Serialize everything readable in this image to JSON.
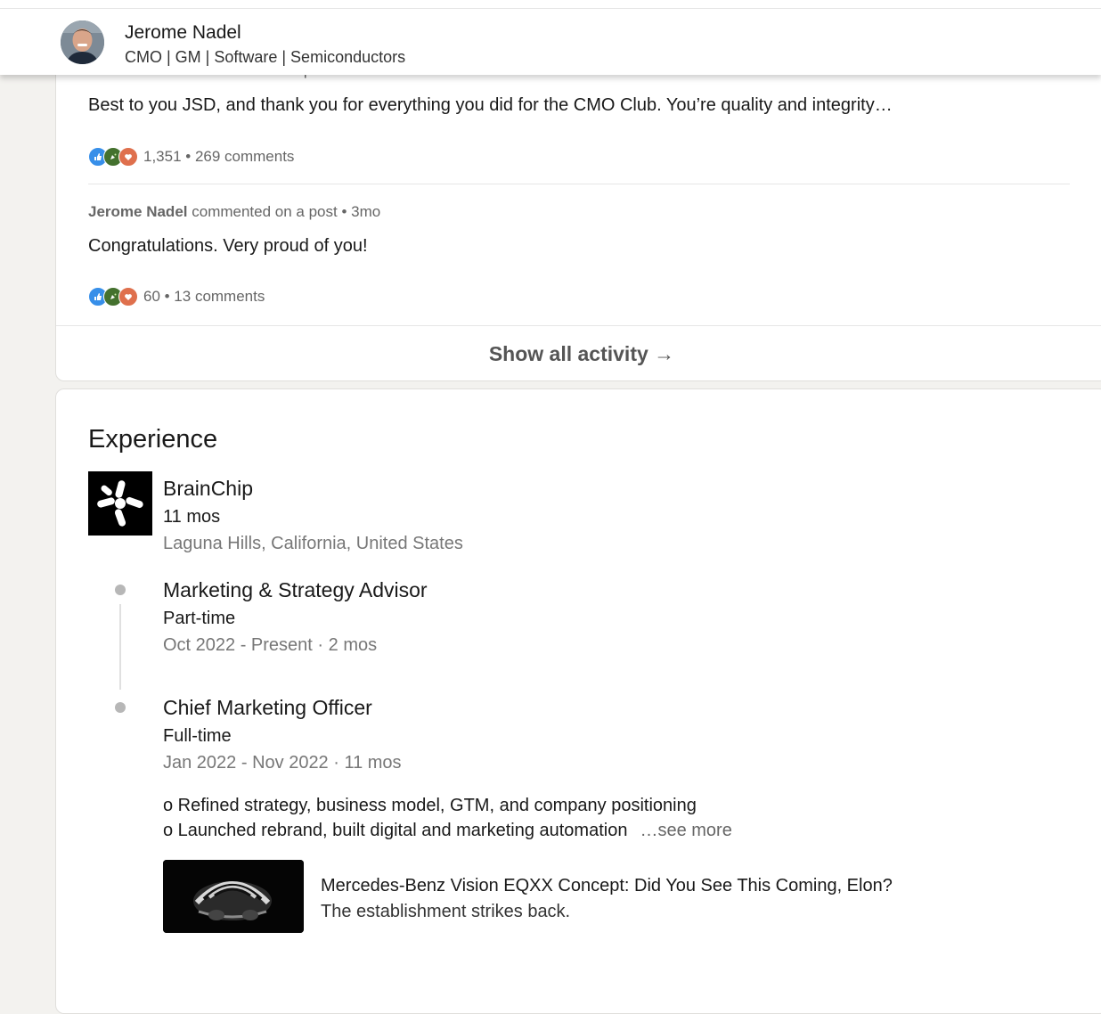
{
  "header": {
    "name": "Jerome Nadel",
    "headline": "CMO | GM | Software | Semiconductors"
  },
  "activity": {
    "ghost_meta": "Jerome Nadel commented on a post • 1mo",
    "items": [
      {
        "text": "Best to you JSD, and thank you for everything you did for the CMO Club. You’re quality and integrity…",
        "stats": "1,351 • 269 comments"
      },
      {
        "author": "Jerome Nadel",
        "action": "commented on a post • 3mo",
        "text": "Congratulations. Very proud of you!",
        "stats": "60 • 13 comments"
      }
    ],
    "show_all": "Show all activity →"
  },
  "experience": {
    "title": "Experience",
    "company": "BrainChip",
    "duration": "11 mos",
    "location": "Laguna Hills, California, United States",
    "roles": [
      {
        "title": "Marketing & Strategy Advisor",
        "type": "Part-time",
        "dates": "Oct 2022 - Present · 2 mos"
      },
      {
        "title": "Chief Marketing Officer",
        "type": "Full-time",
        "dates": "Jan 2022 - Nov 2022 · 11 mos"
      }
    ],
    "description": [
      "o Refined strategy, business model, GTM, and company positioning",
      "o Launched rebrand, built digital and marketing automation"
    ],
    "see_more": "…see more",
    "media": {
      "title": "Mercedes-Benz Vision EQXX Concept: Did You See This Coming, Elon?",
      "subtitle": "The establishment strikes back."
    }
  },
  "colors": {
    "like": "#378fe9",
    "celebrate": "#44712e",
    "love": "#df704d",
    "page_bg": "#f3f2ef"
  }
}
